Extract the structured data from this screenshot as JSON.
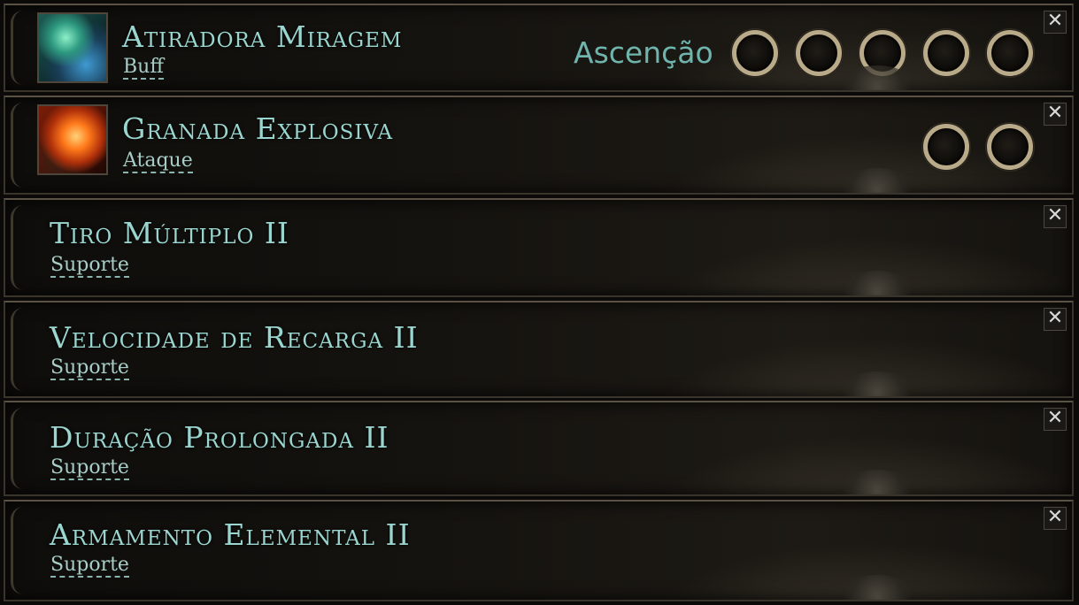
{
  "skills": [
    {
      "name": "Atiradora Miragem",
      "type": "Buff"
    },
    {
      "name": "Granada Explosiva",
      "type": "Ataque"
    },
    {
      "name": "Tiro Múltiplo II",
      "type": "Suporte"
    },
    {
      "name": "Velocidade de Recarga II",
      "type": "Suporte"
    },
    {
      "name": "Duração Prolongada II",
      "type": "Suporte"
    },
    {
      "name": "Armamento Elemental II",
      "type": "Suporte"
    }
  ],
  "ascension_label": "Ascenção",
  "close_glyph": "✕",
  "sockets": {
    "row1": 5,
    "row2": 2
  },
  "colors": {
    "title": "#9ad6cf",
    "socket_ring": "#b9aa8a",
    "ascension": "#6fb5ad"
  }
}
